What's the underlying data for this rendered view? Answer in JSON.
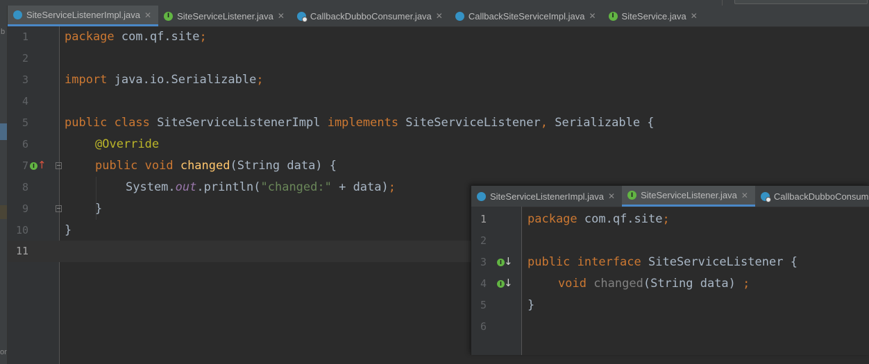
{
  "main_tabs": [
    {
      "label": "SiteServiceListenerImpl.java",
      "icon": "c",
      "active": true
    },
    {
      "label": "SiteServiceListener.java",
      "icon": "i",
      "active": false
    },
    {
      "label": "CallbackDubboConsumer.java",
      "icon": "cs",
      "active": false
    },
    {
      "label": "CallbackSiteServiceImpl.java",
      "icon": "c",
      "active": false
    },
    {
      "label": "SiteService.java",
      "icon": "i",
      "active": false
    }
  ],
  "main_editor": {
    "line_numbers": [
      "1",
      "2",
      "3",
      "4",
      "5",
      "6",
      "7",
      "8",
      "9",
      "10",
      "11"
    ],
    "current_line": 11,
    "code": {
      "l1_kw": "package ",
      "l1_rest": "com.qf.site",
      "l1_semi": ";",
      "l3_kw": "import ",
      "l3_rest": "java.io.Serializable",
      "l3_semi": ";",
      "l5_kw1": "public class ",
      "l5_name": "SiteServiceListenerImpl ",
      "l5_kw2": "implements ",
      "l5_iface": "SiteServiceListener",
      "l5_comma": ", ",
      "l5_ser": "Serializable {",
      "l6_ann": "@Override",
      "l7_kw": "public void ",
      "l7_fn": "changed",
      "l7_rest": "(String data) {",
      "l8_a": "System.",
      "l8_out": "out",
      "l8_b": ".println(",
      "l8_str": "\"changed:\"",
      "l8_c": " + data)",
      "l8_semi": ";",
      "l9": "}",
      "l10": "}"
    }
  },
  "popup_tabs": [
    {
      "label": "SiteServiceListenerImpl.java",
      "icon": "c",
      "active": false
    },
    {
      "label": "SiteServiceListener.java",
      "icon": "i",
      "active": true
    },
    {
      "label": "CallbackDubboConsumer",
      "icon": "cs",
      "active": false
    }
  ],
  "popup_editor": {
    "line_numbers": [
      "1",
      "2",
      "3",
      "4",
      "5",
      "6"
    ],
    "code": {
      "l1_kw": "package ",
      "l1_rest": "com.qf.site",
      "l1_semi": ";",
      "l3_kw": "public interface ",
      "l3_name": "SiteServiceListener {",
      "l4_kw": "void ",
      "l4_fn": "changed",
      "l4_rest": "(String data) ",
      "l4_semi": ";",
      "l5": "}"
    }
  },
  "glyphs": {
    "interface_badge": "I",
    "close": "✕",
    "up_arrow": "↑",
    "down_arrow": "↓"
  },
  "colors": {
    "keyword": "#cc7832",
    "annotation": "#bbb529",
    "method": "#ffc66d",
    "string": "#6a8759",
    "static_field": "#9876aa",
    "tab_underline": "#4a88c7"
  }
}
